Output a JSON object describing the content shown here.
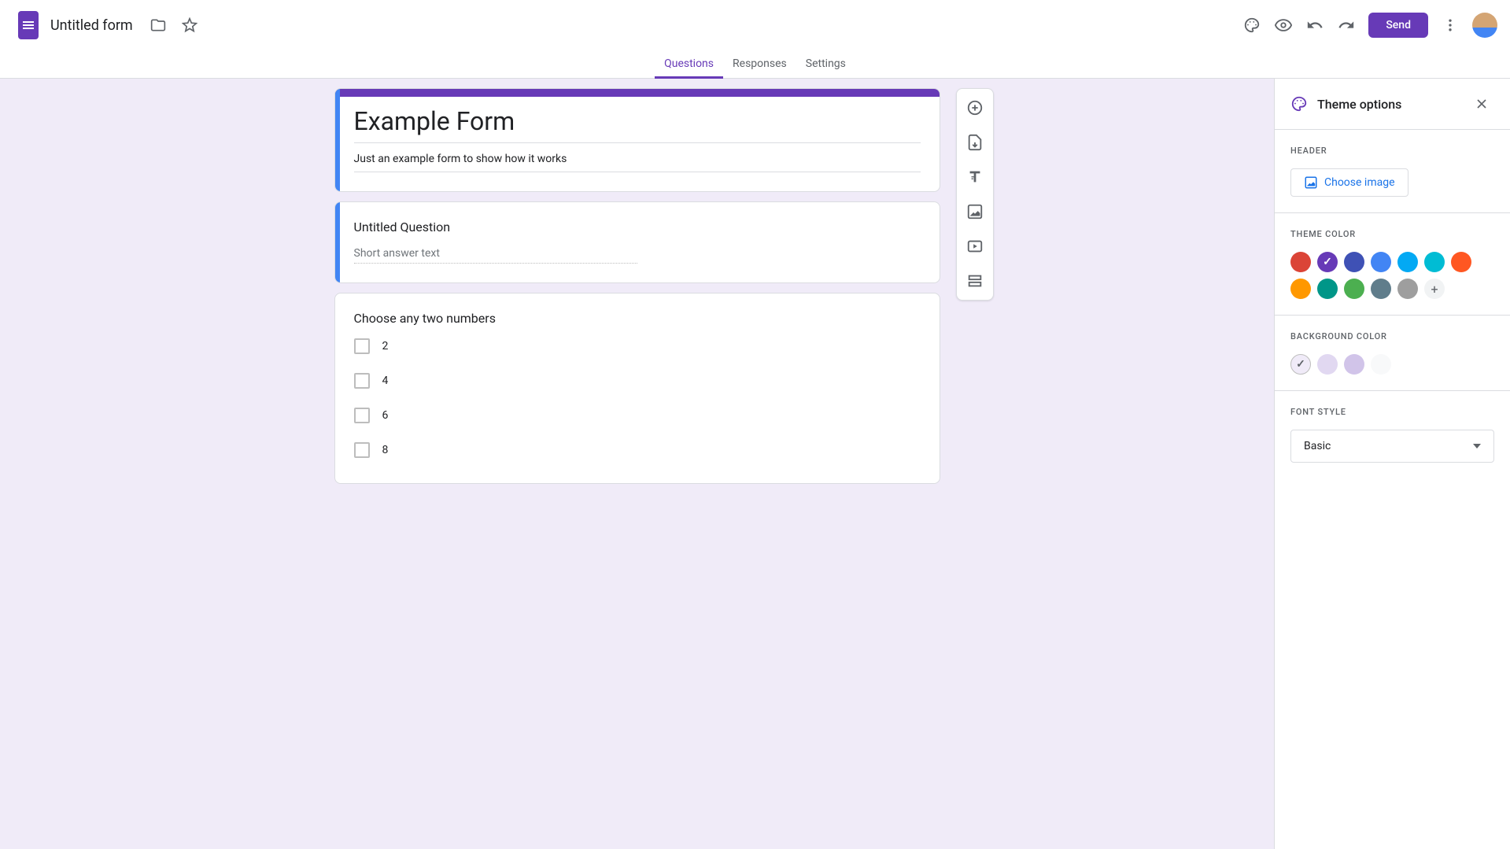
{
  "header": {
    "form_name": "Untitled form",
    "send_label": "Send"
  },
  "tabs": {
    "questions": "Questions",
    "responses": "Responses",
    "settings": "Settings"
  },
  "form": {
    "title": "Example Form",
    "description": "Just an example form to show how it works",
    "q1": {
      "title": "Untitled Question",
      "placeholder": "Short answer text"
    },
    "q2": {
      "title": "Choose any two numbers",
      "options": [
        "2",
        "4",
        "6",
        "8"
      ]
    }
  },
  "theme": {
    "panel_title": "Theme options",
    "header_label": "HEADER",
    "choose_image": "Choose image",
    "theme_color_label": "THEME COLOR",
    "theme_colors": [
      "#db4437",
      "#673ab7",
      "#3f51b5",
      "#4285f4",
      "#03a9f4",
      "#00bcd4",
      "#ff5722",
      "#ff9800",
      "#009688",
      "#4caf50",
      "#607d8b",
      "#9e9e9e"
    ],
    "theme_selected_index": 1,
    "bg_label": "BACKGROUND COLOR",
    "bg_colors": [
      "#f0ebf8",
      "#e1d8f1",
      "#d1c4e9",
      "#f8f9fa"
    ],
    "bg_selected_index": 0,
    "font_label": "FONT STYLE",
    "font_value": "Basic"
  }
}
